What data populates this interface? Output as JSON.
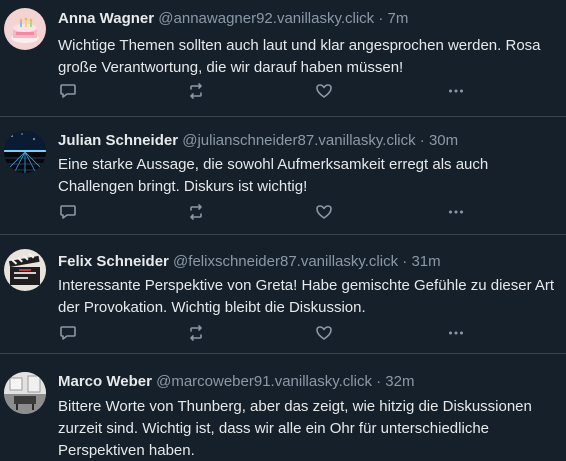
{
  "posts": [
    {
      "name": "Anna Wagner",
      "handle": "@annawagner92.vanillasky.click",
      "time": "7m",
      "text": "Wichtige Themen sollten auch laut und klar angesprochen werden. Rosa große Verantwortung, die wir darauf haben müssen!",
      "avatar": "cake-avatar"
    },
    {
      "name": "Julian Schneider",
      "handle": "@julianschneider87.vanillasky.click",
      "time": "30m",
      "text": "Eine starke Aussage, die sowohl Aufmerksamkeit erregt als auch Challengen bringt. Diskurs ist wichtig!",
      "avatar": "neon-grid-avatar"
    },
    {
      "name": "Felix Schneider",
      "handle": "@felixschneider87.vanillasky.click",
      "time": "31m",
      "text": "Interessante Perspektive von Greta! Habe gemischte Gefühle zu dieser Art der Provokation. Wichtig bleibt die Diskussion.",
      "avatar": "clapperboard-avatar"
    },
    {
      "name": "Marco Weber",
      "handle": "@marcoweber91.vanillasky.click",
      "time": "32m",
      "text": "Bittere Worte von Thunberg, aber das zeigt, wie hitzig die Diskussionen zurzeit sind. Wichtig ist, dass wir alle ein Ohr für unterschiedliche Perspektiven haben.",
      "avatar": "room-avatar"
    }
  ],
  "separator": "·",
  "colors": {
    "background": "#15202b",
    "text": "#e7e9ea",
    "muted": "#8b98a5",
    "divider": "#38444d"
  }
}
